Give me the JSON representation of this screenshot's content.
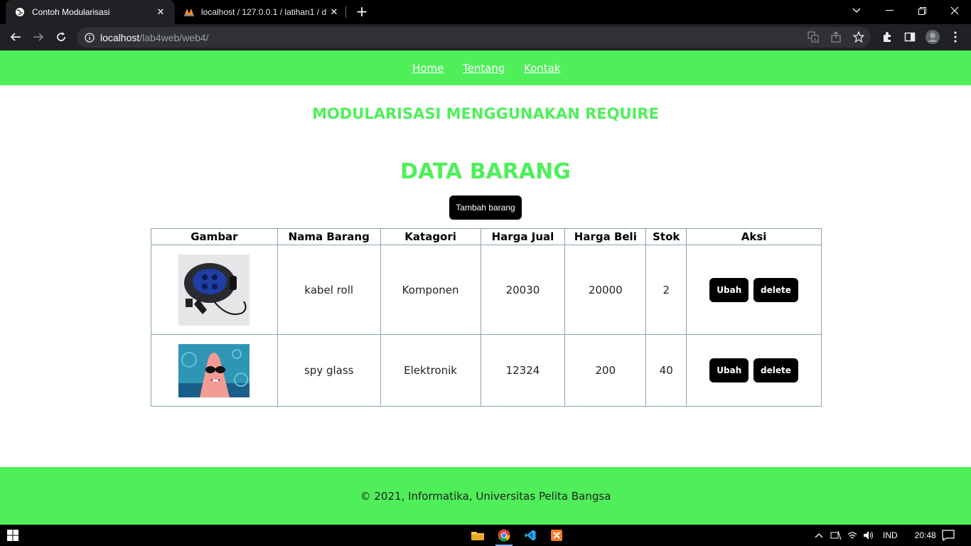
{
  "browser": {
    "tabs": [
      {
        "title": "Contoh Modularisasi",
        "icon": "globe-icon",
        "active": true
      },
      {
        "title": "localhost / 127.0.0.1 / latihan1 / d",
        "icon": "phpmyadmin-icon",
        "active": false
      }
    ],
    "address": {
      "host": "localhost",
      "path": "/lab4web/web4/"
    }
  },
  "nav": {
    "items": [
      "Home",
      "Tentang",
      "Kontak"
    ]
  },
  "page": {
    "subtitle": "MODULARISASI MENGGUNAKAN REQUIRE",
    "title": "DATA BARANG",
    "add_button": "Tambah barang"
  },
  "table": {
    "headers": [
      "Gambar",
      "Nama Barang",
      "Katagori",
      "Harga Jual",
      "Harga Beli",
      "Stok",
      "Aksi"
    ],
    "rows": [
      {
        "nama": "kabel roll",
        "kategori": "Komponen",
        "harga_jual": "20030",
        "harga_beli": "20000",
        "stok": "2",
        "edit": "Ubah",
        "delete": "delete"
      },
      {
        "nama": "spy glass",
        "kategori": "Elektronik",
        "harga_jual": "12324",
        "harga_beli": "200",
        "stok": "40",
        "edit": "Ubah",
        "delete": "delete"
      }
    ]
  },
  "footer": {
    "text": "© 2021, Informatika, Universitas Pelita Bangsa"
  },
  "taskbar": {
    "language": "IND",
    "time": "20:48"
  },
  "colors": {
    "accent_green": "#4fef5a",
    "button_black": "#000000"
  }
}
